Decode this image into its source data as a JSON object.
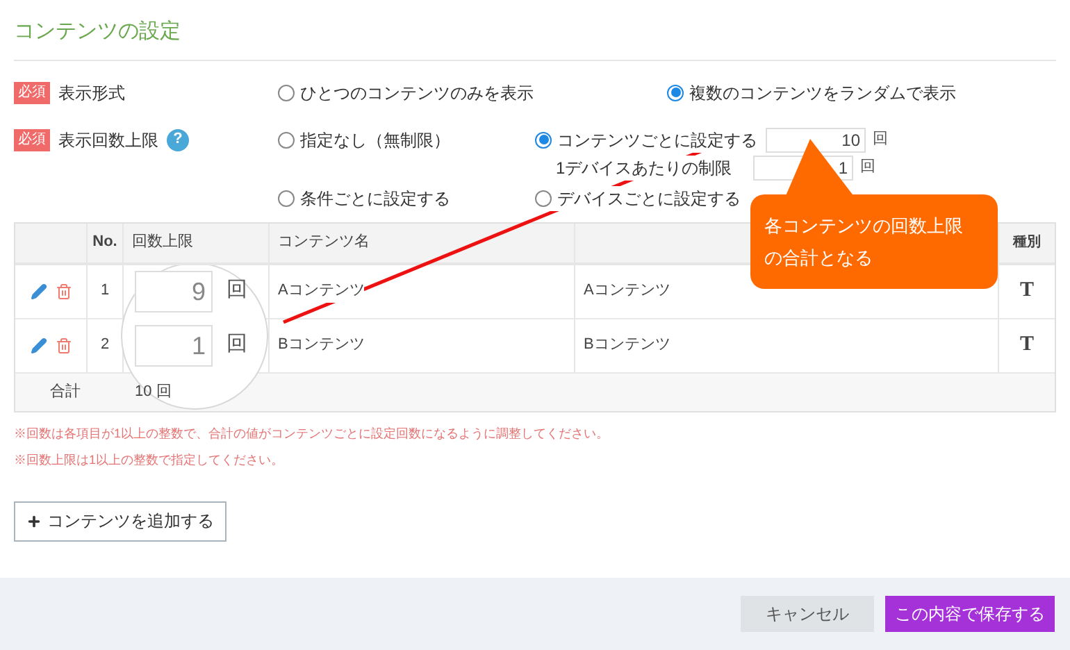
{
  "title": "コンテンツの設定",
  "display_format": {
    "badge": "必須",
    "label": "表示形式",
    "options": [
      {
        "label": "ひとつのコンテンツのみを表示",
        "selected": false
      },
      {
        "label": "複数のコンテンツをランダムで表示",
        "selected": true
      }
    ]
  },
  "display_limit": {
    "badge": "必須",
    "label": "表示回数上限",
    "help": "?",
    "options": [
      {
        "label": "指定なし（無制限）",
        "selected": false
      },
      {
        "label": "コンテンツごとに設定する",
        "selected": true,
        "value": "10",
        "unit": "回"
      },
      {
        "label": "条件ごとに設定する",
        "selected": false
      },
      {
        "label": "デバイスごとに設定する",
        "selected": false
      }
    ],
    "per_device": {
      "label": "1デバイスあたりの制限",
      "value": "1",
      "unit": "回"
    }
  },
  "callout": [
    "各コンテンツの回数上限",
    "の合計となる"
  ],
  "table": {
    "columns": {
      "no": "No.",
      "limit": "回数上限",
      "name": "コンテンツ名",
      "type": "種別"
    },
    "rows": [
      {
        "no": "1",
        "limit": "9",
        "unit": "回",
        "name": "Aコンテンツ",
        "column_5": "Aコンテンツ",
        "type": "T"
      },
      {
        "no": "2",
        "limit": "1",
        "unit": "回",
        "name": "Bコンテンツ",
        "column_5": "Bコンテンツ",
        "type": "T"
      }
    ],
    "total": {
      "label": "合計",
      "value": "10 回"
    }
  },
  "notes": [
    "※回数は各項目が1以上の整数で、合計の値がコンテンツごとに設定回数になるように調整してください。",
    "※回数上限は1以上の整数で指定してください。"
  ],
  "add_button": "コンテンツを追加する",
  "buttons": {
    "cancel": "キャンセル",
    "save": "この内容で保存する"
  }
}
